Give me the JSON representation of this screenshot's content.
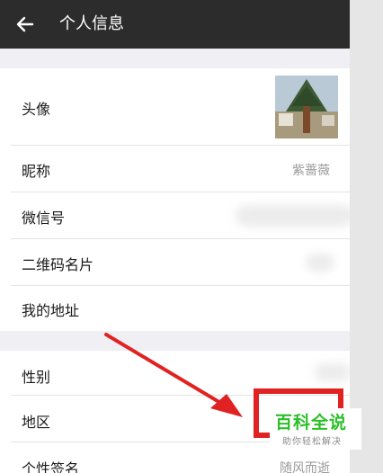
{
  "header": {
    "title": "个人信息",
    "back_icon": "arrow-left-icon"
  },
  "profile_rows": [
    {
      "label": "头像"
    },
    {
      "label": "昵称",
      "value": "紫蔷薇"
    },
    {
      "label": "微信号"
    },
    {
      "label": "二维码名片"
    },
    {
      "label": "我的地址"
    }
  ],
  "detail_rows": [
    {
      "label": "性别"
    },
    {
      "label": "地区"
    },
    {
      "label": "个性签名",
      "value": "随风而逝"
    }
  ],
  "watermark": {
    "brand": "百科全说",
    "tagline": "助你轻松解决"
  },
  "colors": {
    "header_bg": "#2c2c2c",
    "arrow": "#e02222",
    "brand_green": "#2bbf28"
  }
}
